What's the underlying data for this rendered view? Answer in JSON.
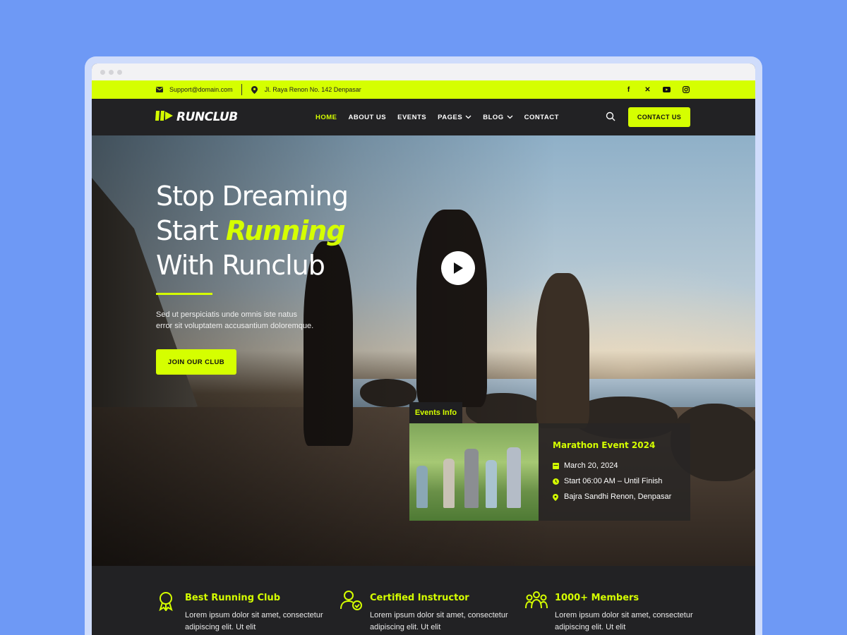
{
  "topbar": {
    "email": "Support@domain.com",
    "address": "Jl. Raya Renon No. 142 Denpasar",
    "social": [
      "facebook-icon",
      "x-icon",
      "youtube-icon",
      "instagram-icon"
    ]
  },
  "nav": {
    "logo": "RUNCLUB",
    "items": [
      {
        "label": "HOME",
        "active": true
      },
      {
        "label": "ABOUT US"
      },
      {
        "label": "EVENTS"
      },
      {
        "label": "PAGES",
        "dropdown": true
      },
      {
        "label": "BLOG",
        "dropdown": true
      },
      {
        "label": "CONTACT"
      }
    ],
    "cta": "CONTACT US"
  },
  "hero": {
    "title_line1": "Stop Dreaming",
    "title_line2_start": "Start ",
    "title_line2_highlight": "Running",
    "title_line3": "With Runclub",
    "description": "Sed ut perspiciatis unde omnis iste natus error sit voluptatem accusantium doloremque.",
    "button": "JOIN OUR CLUB"
  },
  "event": {
    "tag": "Events Info",
    "title": "Marathon Event 2024",
    "date": "March 20, 2024",
    "time": "Start 06:00 AM – Until Finish",
    "location": "Bajra Sandhi Renon, Denpasar"
  },
  "features": [
    {
      "title": "Best Running Club",
      "desc": "Lorem ipsum dolor sit amet, consectetur adipiscing elit. Ut elit"
    },
    {
      "title": "Certified Instructor",
      "desc": "Lorem ipsum dolor sit amet, consectetur adipiscing elit. Ut elit"
    },
    {
      "title": "1000+ Members",
      "desc": "Lorem ipsum dolor sit amet, consectetur adipiscing elit. Ut elit"
    }
  ],
  "colors": {
    "accent": "#d5ff00",
    "dark": "#222224",
    "background": "#6e99f5"
  }
}
